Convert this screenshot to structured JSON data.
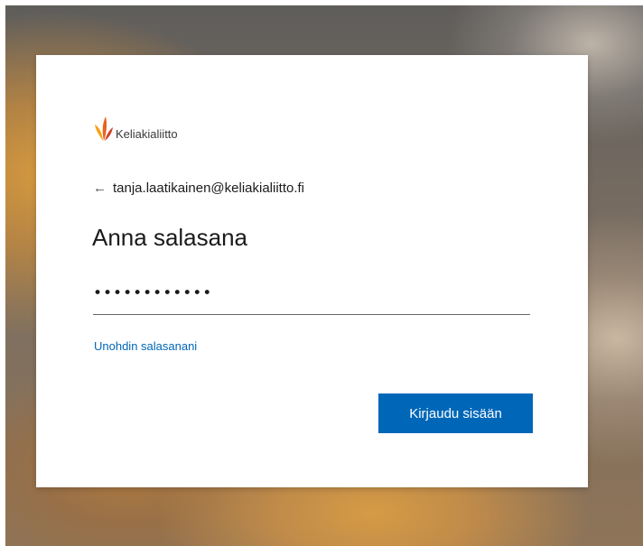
{
  "logo": {
    "text": "Keliakialiitto",
    "colors": [
      "#f5a21b",
      "#e8631c",
      "#d6402a"
    ]
  },
  "identity": {
    "back_icon": "arrow-left-icon",
    "email": "tanja.laatikainen@keliakialiitto.fi"
  },
  "page": {
    "title": "Anna salasana"
  },
  "password": {
    "value": "••••••••••••"
  },
  "links": {
    "forgot": "Unohdin salasanani"
  },
  "actions": {
    "signin_label": "Kirjaudu sisään",
    "accent": "#0067b8"
  }
}
